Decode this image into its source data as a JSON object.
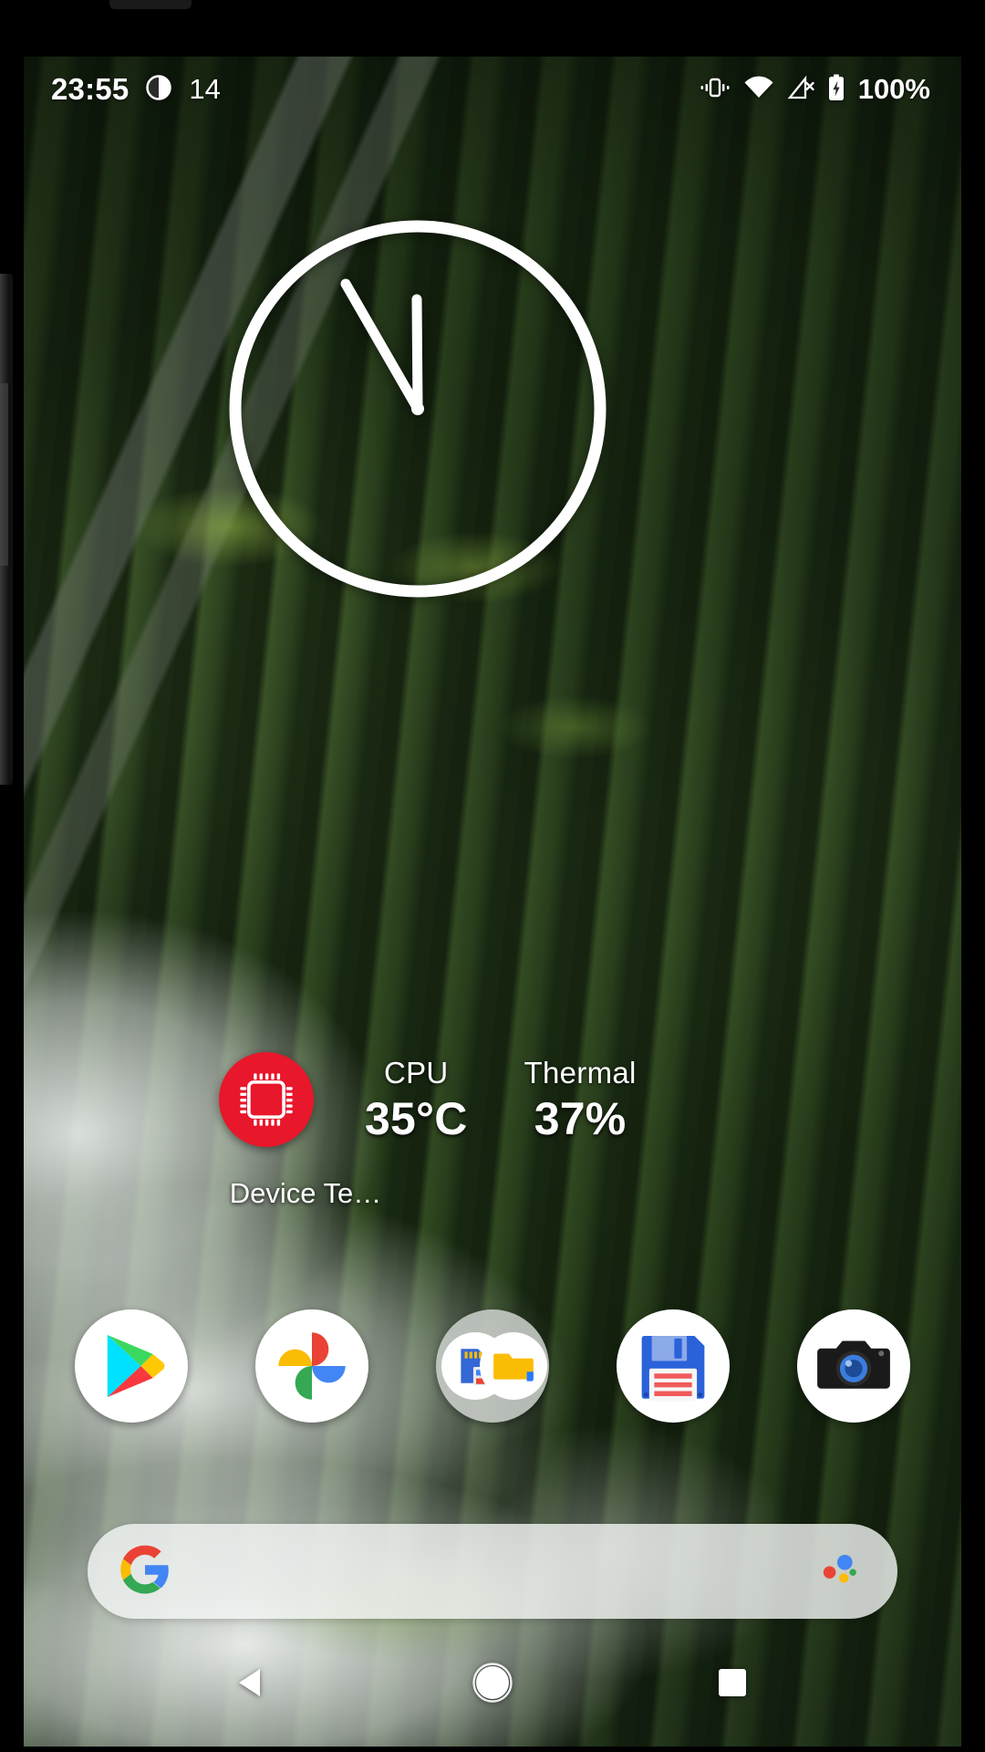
{
  "status_bar": {
    "time": "23:55",
    "notification_count": "14",
    "notification_icon": "clock-badge-icon",
    "vibrate_icon": "vibrate-icon",
    "wifi_icon": "wifi-icon",
    "signal_icon": "no-sim-signal-icon",
    "battery_icon": "battery-charging-icon",
    "battery_percent": "100%"
  },
  "clock_widget": {
    "name": "analog-clock-widget",
    "hour": 23,
    "minute": 55,
    "stroke_color": "#ffffff"
  },
  "temp_widget": {
    "app_label": "Device Te…",
    "icon": "cpu-flame-icon",
    "icon_color": "#e8172b",
    "stats": [
      {
        "label": "CPU",
        "value": "35°C"
      },
      {
        "label": "Thermal",
        "value": "37%"
      }
    ]
  },
  "dock": {
    "items": [
      {
        "label": "Play Store",
        "icon": "play-store-icon"
      },
      {
        "label": "Photos",
        "icon": "google-photos-icon"
      },
      {
        "label": "Tools Folder",
        "icon": "app-folder-icon"
      },
      {
        "label": "Files",
        "icon": "floppy-disk-icon"
      },
      {
        "label": "Camera",
        "icon": "camera-icon"
      }
    ]
  },
  "search": {
    "google_icon": "google-g-icon",
    "assistant_icon": "google-assistant-icon",
    "placeholder": "",
    "value": ""
  },
  "nav_bar": {
    "back": "back-triangle-icon",
    "home": "home-circle-icon",
    "recents": "recents-square-icon"
  },
  "colors": {
    "accent_red": "#e8172b",
    "google_blue": "#4285F4",
    "google_red": "#EA4335",
    "google_yellow": "#FBBC05",
    "google_green": "#34A853"
  }
}
